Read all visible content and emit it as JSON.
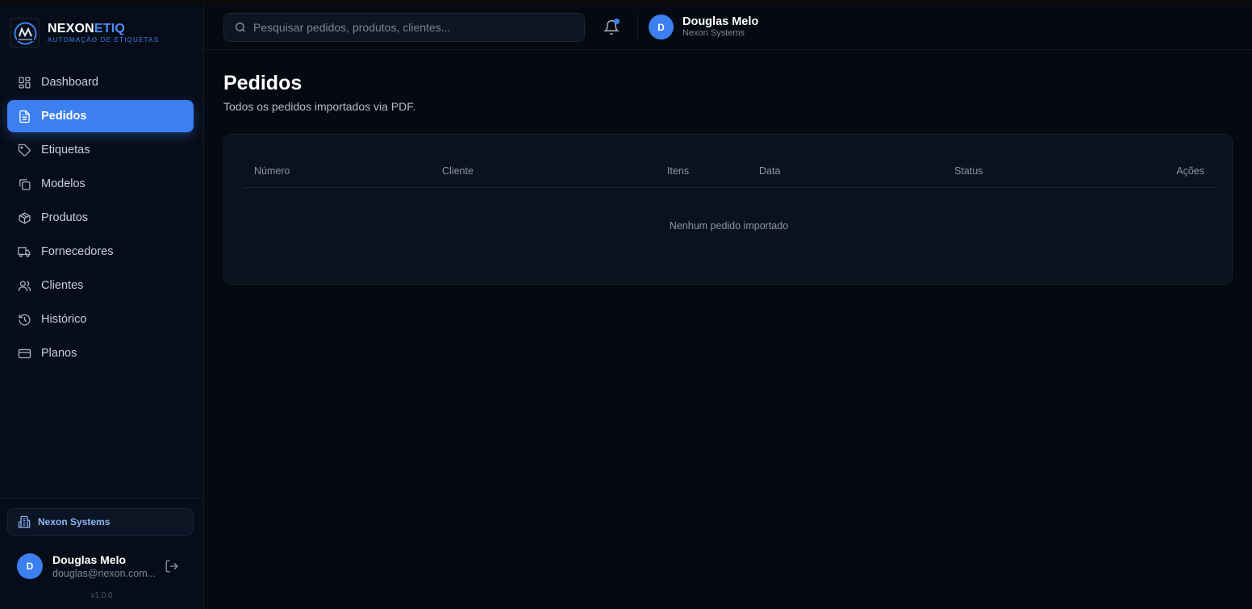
{
  "brand": {
    "name_part1": "NEXON",
    "name_part2": "ETIQ",
    "tagline": "AUTOMAÇÃO DE ETIQUETAS",
    "logo_icon": "nexonetiq-logo-icon"
  },
  "sidebar": {
    "items": [
      {
        "label": "Dashboard",
        "icon": "layout-dashboard-icon",
        "active": false
      },
      {
        "label": "Pedidos",
        "icon": "file-text-icon",
        "active": true
      },
      {
        "label": "Etiquetas",
        "icon": "tag-icon",
        "active": false
      },
      {
        "label": "Modelos",
        "icon": "copy-icon",
        "active": false
      },
      {
        "label": "Produtos",
        "icon": "package-icon",
        "active": false
      },
      {
        "label": "Fornecedores",
        "icon": "truck-icon",
        "active": false
      },
      {
        "label": "Clientes",
        "icon": "users-icon",
        "active": false
      },
      {
        "label": "Histórico",
        "icon": "history-icon",
        "active": false
      },
      {
        "label": "Planos",
        "icon": "credit-card-icon",
        "active": false
      }
    ],
    "organization": "Nexon Systems",
    "user": {
      "initial": "D",
      "name": "Douglas Melo",
      "email": "douglas@nexon.com..."
    },
    "version": "v1.0.0"
  },
  "header": {
    "search_placeholder": "Pesquisar pedidos, produtos, clientes...",
    "has_notification": true,
    "user": {
      "initial": "D",
      "name": "Douglas Melo",
      "company": "Nexon Systems"
    }
  },
  "main": {
    "title": "Pedidos",
    "subtitle": "Todos os pedidos importados via PDF.",
    "table": {
      "columns": [
        "Número",
        "Cliente",
        "Itens",
        "Data",
        "Status",
        "Ações"
      ],
      "empty_message": "Nenhum pedido importado"
    }
  },
  "colors": {
    "accent": "#3b7ff0",
    "background": "#050912",
    "sidebar": "#070d18",
    "card": "#0a121e"
  }
}
